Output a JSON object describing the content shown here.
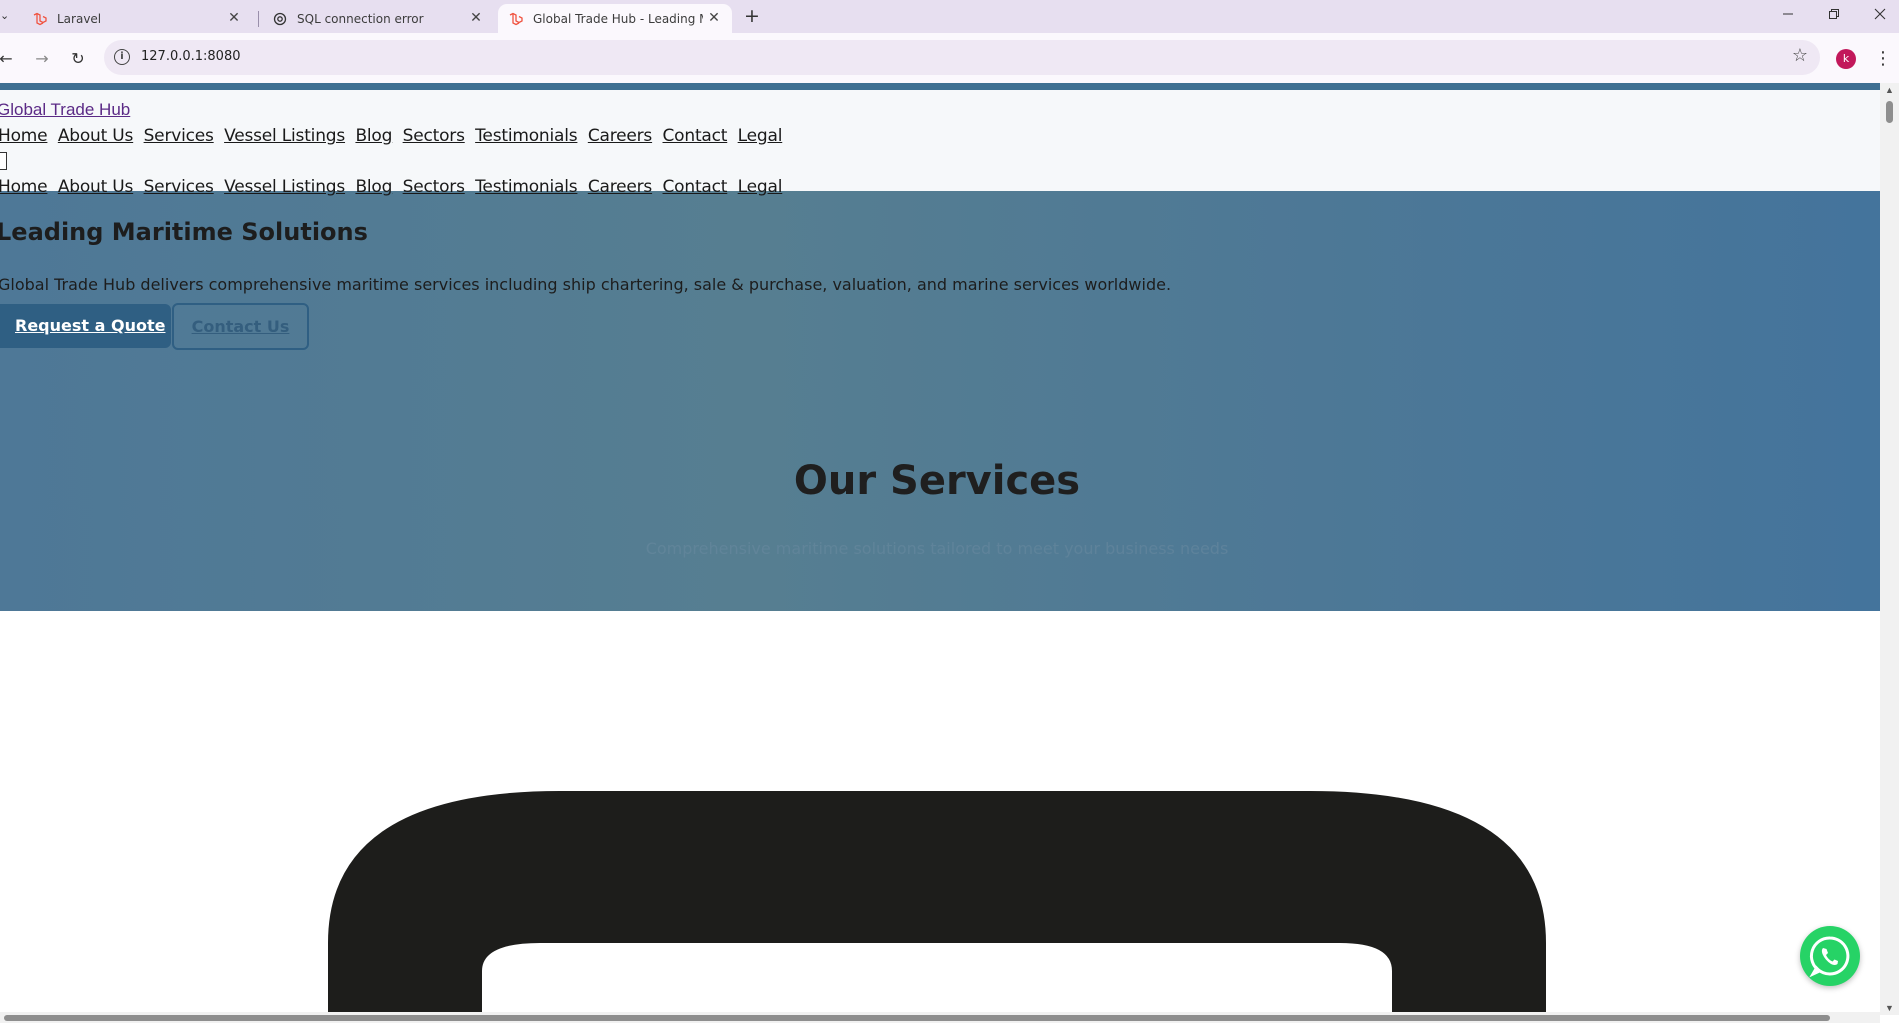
{
  "browser": {
    "tabs": [
      {
        "title": "Laravel",
        "icon": "laravel-icon"
      },
      {
        "title": "SQL connection error",
        "icon": "openai-icon"
      },
      {
        "title": "Global Trade Hub - Leading Ma",
        "icon": "laravel-icon",
        "active": true
      }
    ],
    "url": "127.0.0.1:8080",
    "profile_initial": "k",
    "profile_color": "#c2185b"
  },
  "site": {
    "brand": "Global Trade Hub",
    "nav": [
      "Home",
      "About Us",
      "Services",
      "Vessel Listings",
      "Blog",
      "Sectors",
      "Testimonials",
      "Careers",
      "Contact",
      "Legal"
    ],
    "hero": {
      "title": "Leading Maritime Solutions",
      "text": "Global Trade Hub delivers comprehensive maritime services including ship chartering, sale & purchase, valuation, and marine services worldwide.",
      "primary_button": "Request a Quote",
      "secondary_button": "Contact Us"
    },
    "services": {
      "title": "Our Services",
      "subtitle": "Comprehensive maritime solutions tailored to meet your business needs"
    },
    "colors": {
      "hero_bg": "#4e7897",
      "primary": "#2f5f83",
      "brand_link": "#5b2a86",
      "whatsapp": "#26d366"
    }
  }
}
